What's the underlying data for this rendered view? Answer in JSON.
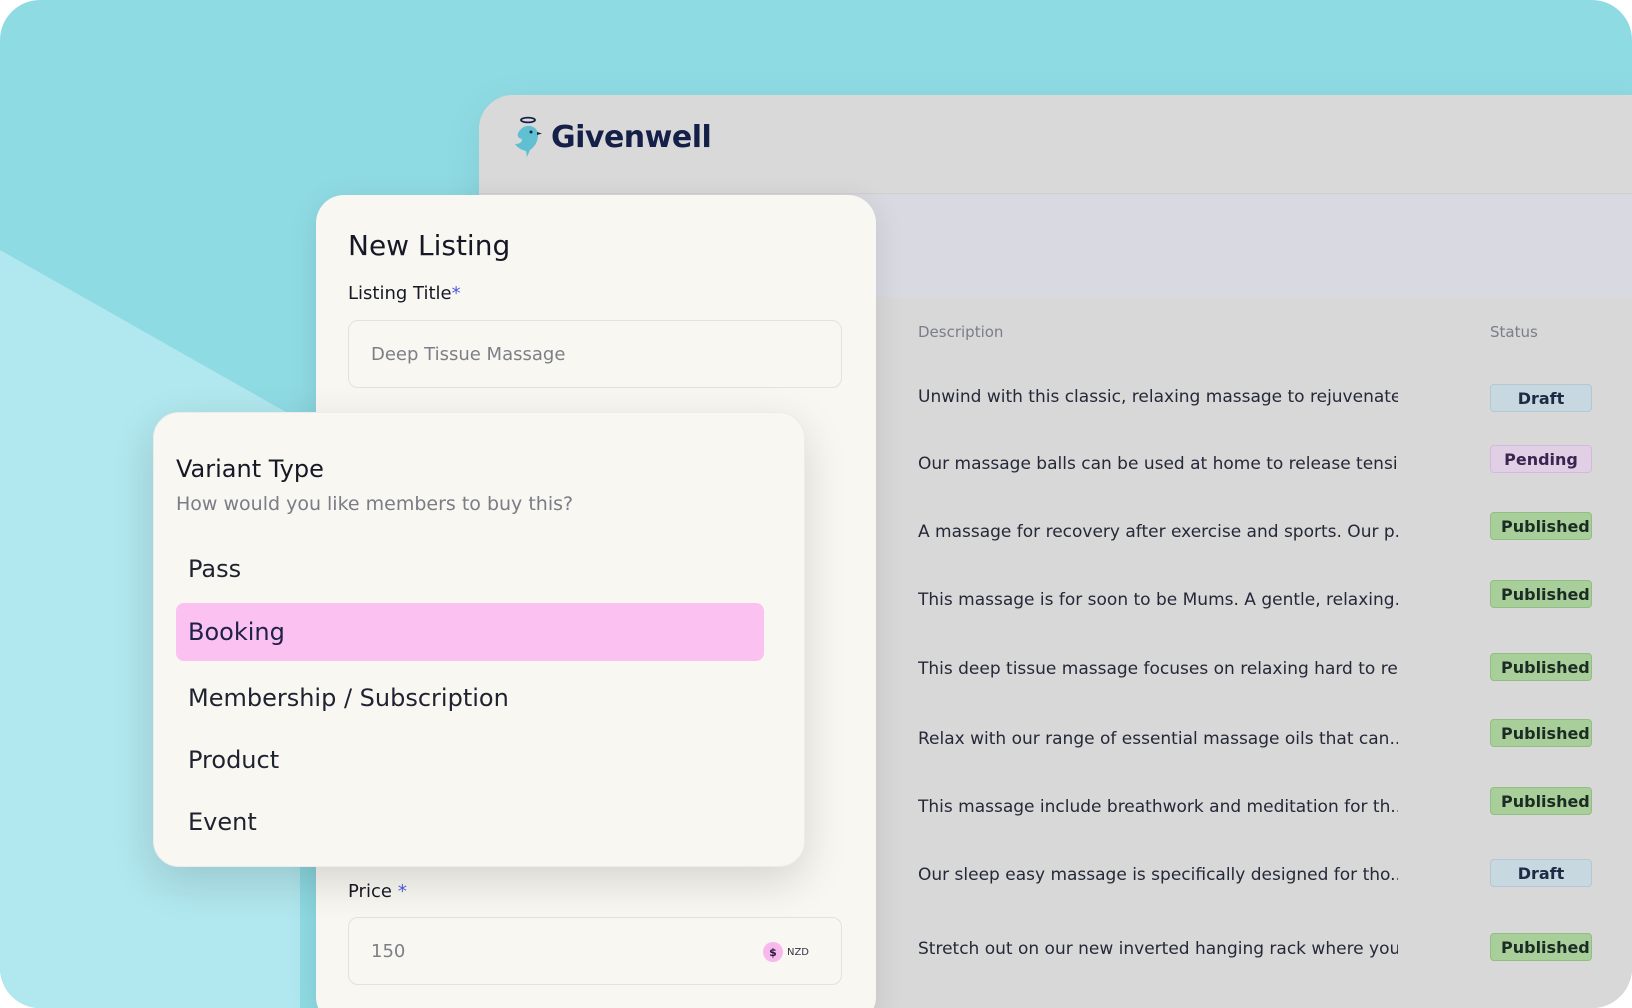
{
  "app": {
    "brand": "Givenwell"
  },
  "table": {
    "headers": {
      "description": "Description",
      "status": "Status"
    },
    "rows": [
      {
        "description": "Unwind with this classic, relaxing massage to rejuvenate...",
        "status": "Draft"
      },
      {
        "description": "Our massage balls can be used at home to release tensi...",
        "status": "Pending"
      },
      {
        "description": "A massage for recovery after exercise and sports. Our p...",
        "status": "Published"
      },
      {
        "description": "This massage is for soon to be Mums. A gentle, relaxing...",
        "status": "Published"
      },
      {
        "description": "This deep tissue massage focuses on relaxing hard to re...",
        "status": "Published"
      },
      {
        "description": "Relax with our range of essential massage oils that can...",
        "status": "Published"
      },
      {
        "description": "This massage include breathwork and meditation for th...",
        "status": "Published"
      },
      {
        "description": "Our sleep easy massage is specifically designed for tho...",
        "status": "Draft"
      },
      {
        "description": "Stretch out on our new inverted hanging rack where you...",
        "status": "Published"
      }
    ]
  },
  "listing": {
    "title": "New Listing",
    "listing_title_label": "Listing Title",
    "required_mark": "*",
    "listing_title_value": "Deep Tissue Massage",
    "price_label": "Price",
    "price_value": "150",
    "currency_symbol": "$",
    "currency_code": "NZD"
  },
  "variant": {
    "title": "Variant Type",
    "subtitle": "How would you like members to buy this?",
    "options": [
      "Pass",
      "Booking",
      "Membership / Subscription",
      "Product",
      "Event"
    ],
    "selected": "Booking"
  },
  "colors": {
    "background": "#8fdbe4",
    "selected_option": "#fbc1f1",
    "brand_text": "#142048",
    "required_accent": "#4a5be0"
  },
  "icons": {
    "logo": "bird-with-halo-icon",
    "currency": "dollar-icon"
  }
}
